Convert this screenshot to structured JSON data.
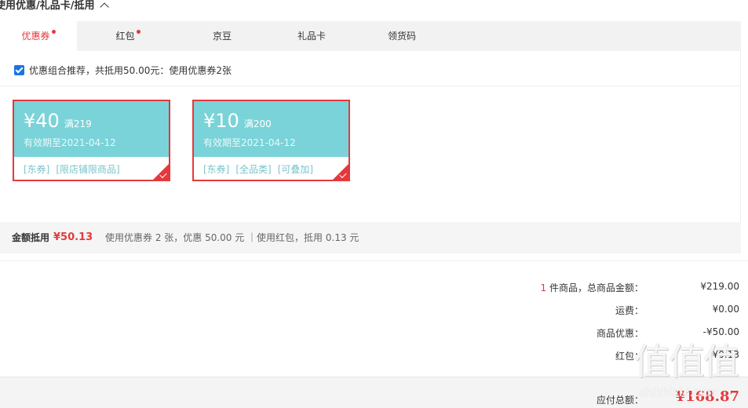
{
  "section": {
    "title": "使用优惠/礼品卡/抵用"
  },
  "tabs": [
    {
      "label": "优惠券",
      "active": true,
      "badge": true
    },
    {
      "label": "红包",
      "active": false,
      "badge": true
    },
    {
      "label": "京豆",
      "active": false,
      "badge": false
    },
    {
      "label": "礼品卡",
      "active": false,
      "badge": false
    },
    {
      "label": "领货码",
      "active": false,
      "badge": false
    }
  ],
  "recommend": {
    "checked": true,
    "text": "优惠组合推荐，共抵用50.00元：使用优惠券2张"
  },
  "coupons": [
    {
      "amount": "¥40",
      "condition": "满219",
      "expire": "有效期至2021-04-12",
      "tags": [
        "[东券]",
        "[限店铺限商品]"
      ],
      "selected": true
    },
    {
      "amount": "¥10",
      "condition": "满200",
      "expire": "有效期至2021-04-12",
      "tags": [
        "[东券]",
        "[全品类]",
        "[可叠加]"
      ],
      "selected": true
    }
  ],
  "summary": {
    "label": "金额抵用",
    "amount": "¥50.13",
    "detail": "使用优惠券 2 张，优惠 50.00 元 ｜使用红包，抵用 0.13 元"
  },
  "totals": {
    "item_count": "1",
    "goods_label": " 件商品，总商品金额：",
    "goods_value": "¥219.00",
    "shipping_label": "运费：",
    "shipping_value": "¥0.00",
    "discount_label": "商品优惠：",
    "discount_value": "-¥50.00",
    "redpacket_label": "红包：",
    "redpacket_value": "-¥0.13",
    "payable_label": "应付总额：",
    "payable_value": "¥168.87"
  },
  "watermark": {
    "glyphs": "值值值",
    "url": "zhizhizhi.com"
  },
  "colors": {
    "accent": "#e4393c",
    "coupon_teal": "#7ad3d8",
    "checkbox": "#1a73e8"
  }
}
